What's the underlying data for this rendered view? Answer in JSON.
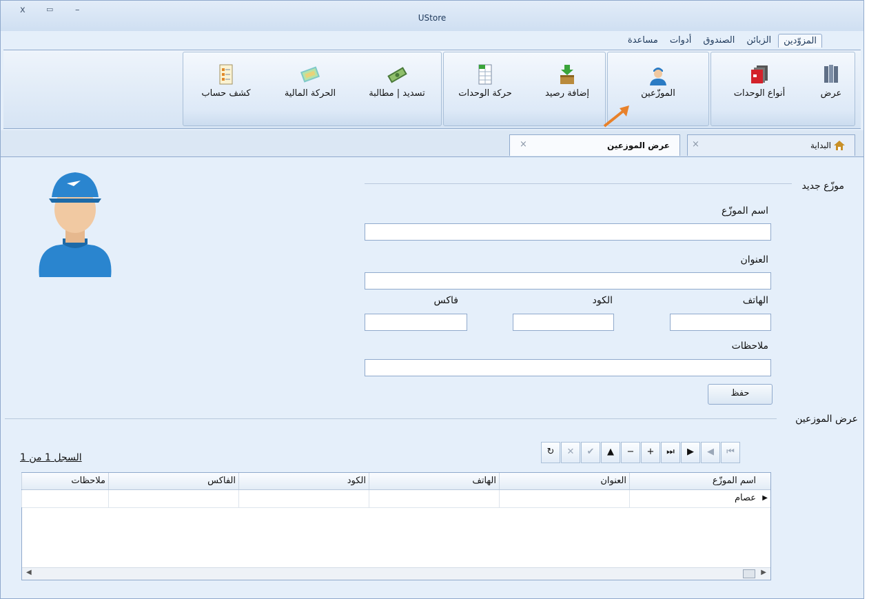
{
  "window": {
    "title": "UStore",
    "controls": {
      "close": "x",
      "restore": "▭",
      "minimize": "–"
    }
  },
  "ribbon_tabs": [
    {
      "label": "المزوّدين",
      "active": true
    },
    {
      "label": "الزبائن",
      "active": false
    },
    {
      "label": "الصندوق",
      "active": false
    },
    {
      "label": "أدوات",
      "active": false
    },
    {
      "label": "مساعدة",
      "active": false
    }
  ],
  "ribbon_buttons": {
    "view": "عرض",
    "unit_types": "أنواع الوحدات",
    "distributors": "الموزّعين",
    "add_balance": "إضافة رصيد",
    "units_movement": "حركة الوحدات",
    "payment_claim": "تسديد | مطالبة",
    "financial_movement": "الحركة المالية",
    "account_statement": "كشف حساب"
  },
  "doc_tabs": {
    "home": {
      "label": "البداية",
      "close": "×"
    },
    "distributors_view": {
      "label": "عرض الموزعين",
      "close": "×"
    }
  },
  "form": {
    "section_title": "موزّع جديد",
    "name_label": "اسم الموزّع",
    "address_label": "العنوان",
    "phone_label": "الهاتف",
    "code_label": "الكود",
    "fax_label": "فاكس",
    "notes_label": "ملاحظات",
    "name_value": "",
    "address_value": "",
    "phone_value": "",
    "code_value": "",
    "fax_value": "",
    "notes_value": "",
    "save_label": "حفظ"
  },
  "list": {
    "section_title": "عرض الموزعين",
    "record_info": "السجل 1 من 1",
    "nav_buttons": [
      "⏮",
      "◀",
      "▶",
      "⏭",
      "+",
      "−",
      "▲",
      "✔",
      "✕",
      "↻"
    ],
    "columns": [
      "اسم الموزّع",
      "العنوان",
      "الهاتف",
      "الكود",
      "الفاكس",
      "ملاحظات"
    ],
    "rows": [
      [
        "عصام",
        "",
        "",
        "",
        "",
        ""
      ]
    ]
  }
}
